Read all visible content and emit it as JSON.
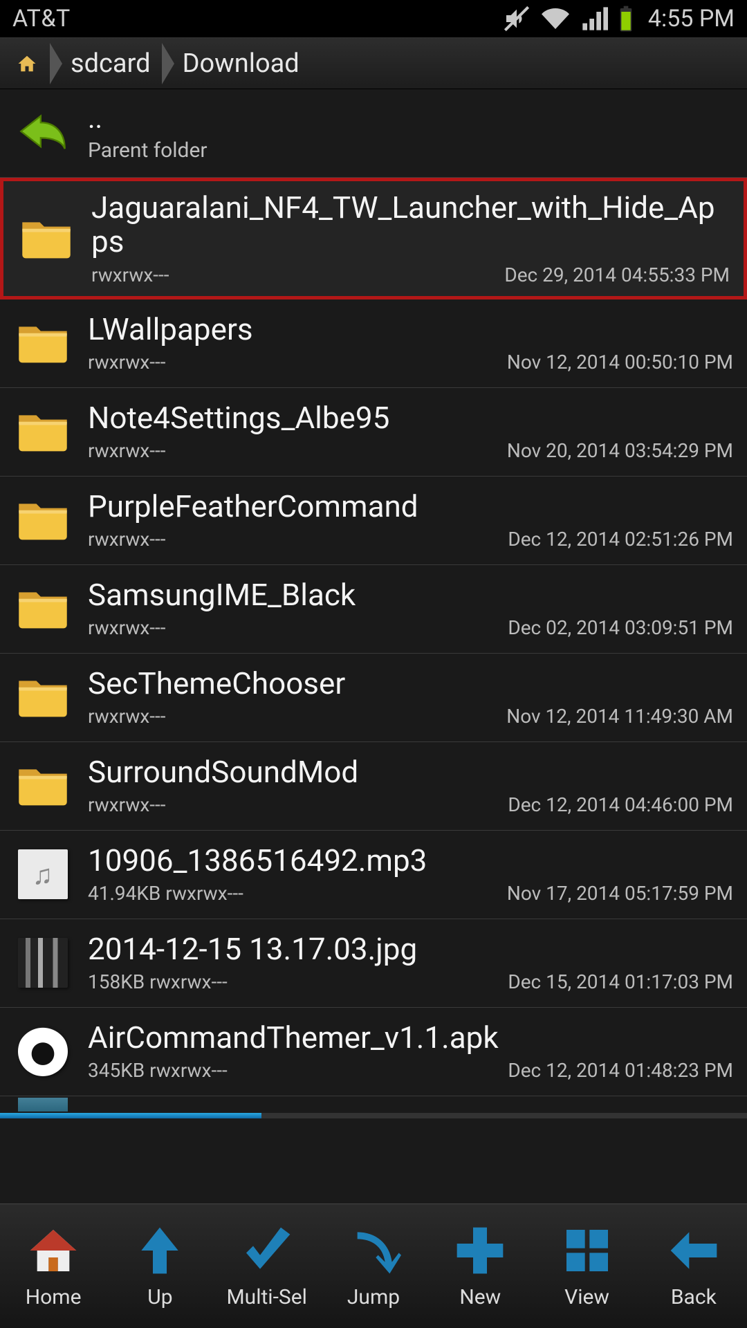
{
  "status": {
    "carrier": "AT&T",
    "clock": "4:55 PM"
  },
  "breadcrumb": {
    "items": [
      "sdcard",
      "Download"
    ]
  },
  "parent": {
    "name": "..",
    "sub": "Parent folder"
  },
  "files": [
    {
      "name": "Jaguaralani_NF4_TW_Launcher_with_Hide_Apps",
      "perms": "rwxrwx---",
      "date": "Dec 29, 2014 04:55:33 PM",
      "kind": "folder",
      "highlight": true
    },
    {
      "name": "LWallpapers",
      "perms": "rwxrwx---",
      "date": "Nov 12, 2014 00:50:10 PM",
      "kind": "folder"
    },
    {
      "name": "Note4Settings_Albe95",
      "perms": "rwxrwx---",
      "date": "Nov 20, 2014 03:54:29 PM",
      "kind": "folder"
    },
    {
      "name": "PurpleFeatherCommand",
      "perms": "rwxrwx---",
      "date": "Dec 12, 2014 02:51:26 PM",
      "kind": "folder"
    },
    {
      "name": "SamsungIME_Black",
      "perms": "rwxrwx---",
      "date": "Dec 02, 2014 03:09:51 PM",
      "kind": "folder"
    },
    {
      "name": "SecThemeChooser",
      "perms": "rwxrwx---",
      "date": "Nov 12, 2014 11:49:30 AM",
      "kind": "folder"
    },
    {
      "name": "SurroundSoundMod",
      "perms": "rwxrwx---",
      "date": "Dec 12, 2014 04:46:00 PM",
      "kind": "folder"
    },
    {
      "name": "10906_1386516492.mp3",
      "perms": "41.94KB rwxrwx---",
      "date": "Nov 17, 2014 05:17:59 PM",
      "kind": "music"
    },
    {
      "name": "2014-12-15 13.17.03.jpg",
      "perms": "158KB rwxrwx---",
      "date": "Dec 15, 2014 01:17:03 PM",
      "kind": "image"
    },
    {
      "name": "AirCommandThemer_v1.1.apk",
      "perms": "345KB rwxrwx---",
      "date": "Dec 12, 2014 01:48:23 PM",
      "kind": "apk"
    }
  ],
  "toolbar": {
    "home": "Home",
    "up": "Up",
    "multisel": "Multi-Sel",
    "jump": "Jump",
    "new": "New",
    "view": "View",
    "back": "Back"
  }
}
